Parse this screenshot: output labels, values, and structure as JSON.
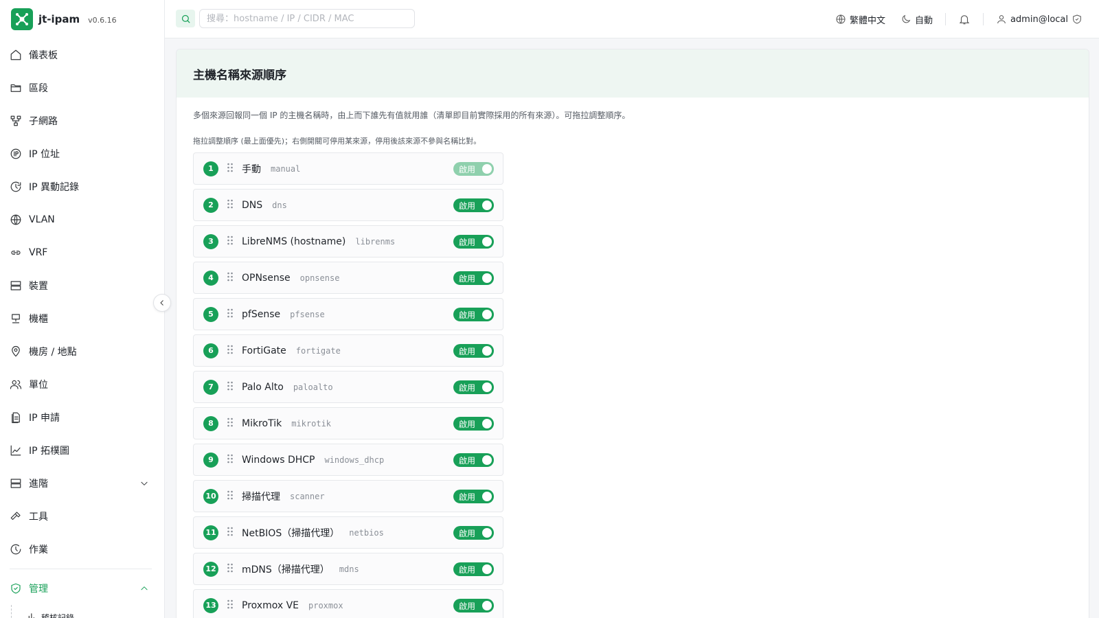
{
  "brand": {
    "name": "jt-ipam",
    "version": "v0.6.16"
  },
  "sidebar": {
    "items": [
      {
        "label": "儀表板",
        "icon": "home-icon"
      },
      {
        "label": "區段",
        "icon": "folder-icon"
      },
      {
        "label": "子網路",
        "icon": "network-icon"
      },
      {
        "label": "IP 位址",
        "icon": "ip-icon"
      },
      {
        "label": "IP 異動記錄",
        "icon": "history-icon"
      },
      {
        "label": "VLAN",
        "icon": "globe-icon"
      },
      {
        "label": "VRF",
        "icon": "link-icon"
      },
      {
        "label": "裝置",
        "icon": "server-icon"
      },
      {
        "label": "機櫃",
        "icon": "rack-icon"
      },
      {
        "label": "機房 / 地點",
        "icon": "location-icon"
      },
      {
        "label": "單位",
        "icon": "users-icon"
      },
      {
        "label": "IP 申請",
        "icon": "document-icon"
      },
      {
        "label": "IP 拓樸圖",
        "icon": "chart-icon"
      },
      {
        "label": "進階",
        "icon": "server-icon"
      },
      {
        "label": "工具",
        "icon": "hammer-icon"
      },
      {
        "label": "作業",
        "icon": "clock-icon"
      }
    ],
    "admin": {
      "label": "管理",
      "icon": "shield-icon"
    },
    "sub_item": "稽核記錄"
  },
  "header": {
    "search_placeholder": "搜尋：hostname / IP / CIDR / MAC",
    "language": "繁體中文",
    "theme": "自動",
    "user": "admin@local"
  },
  "page": {
    "title": "主機名稱來源順序",
    "description": "多個來源回報同一個 IP 的主機名稱時，由上而下誰先有值就用誰（清單即目前實際採用的所有來源）。可拖拉調整順序。",
    "hint": "拖拉調整順序 (最上面優先)；右側開關可停用某來源，停用後該來源不參與名稱比對。",
    "toggle_label": "啟用"
  },
  "sources": [
    {
      "num": "1",
      "name": "手動",
      "key": "manual",
      "enabled": true,
      "locked": true
    },
    {
      "num": "2",
      "name": "DNS",
      "key": "dns",
      "enabled": true
    },
    {
      "num": "3",
      "name": "LibreNMS (hostname)",
      "key": "librenms",
      "enabled": true
    },
    {
      "num": "4",
      "name": "OPNsense",
      "key": "opnsense",
      "enabled": true
    },
    {
      "num": "5",
      "name": "pfSense",
      "key": "pfsense",
      "enabled": true
    },
    {
      "num": "6",
      "name": "FortiGate",
      "key": "fortigate",
      "enabled": true
    },
    {
      "num": "7",
      "name": "Palo Alto",
      "key": "paloalto",
      "enabled": true
    },
    {
      "num": "8",
      "name": "MikroTik",
      "key": "mikrotik",
      "enabled": true
    },
    {
      "num": "9",
      "name": "Windows DHCP",
      "key": "windows_dhcp",
      "enabled": true
    },
    {
      "num": "10",
      "name": "掃描代理",
      "key": "scanner",
      "enabled": true
    },
    {
      "num": "11",
      "name": "NetBIOS（掃描代理）",
      "key": "netbios",
      "enabled": true
    },
    {
      "num": "12",
      "name": "mDNS（掃描代理）",
      "key": "mdns",
      "enabled": true
    },
    {
      "num": "13",
      "name": "Proxmox VE",
      "key": "proxmox",
      "enabled": true
    }
  ],
  "colors": {
    "accent": "#18a058",
    "accent_light": "#8fd0ad",
    "header_bg": "#eef6f2"
  }
}
